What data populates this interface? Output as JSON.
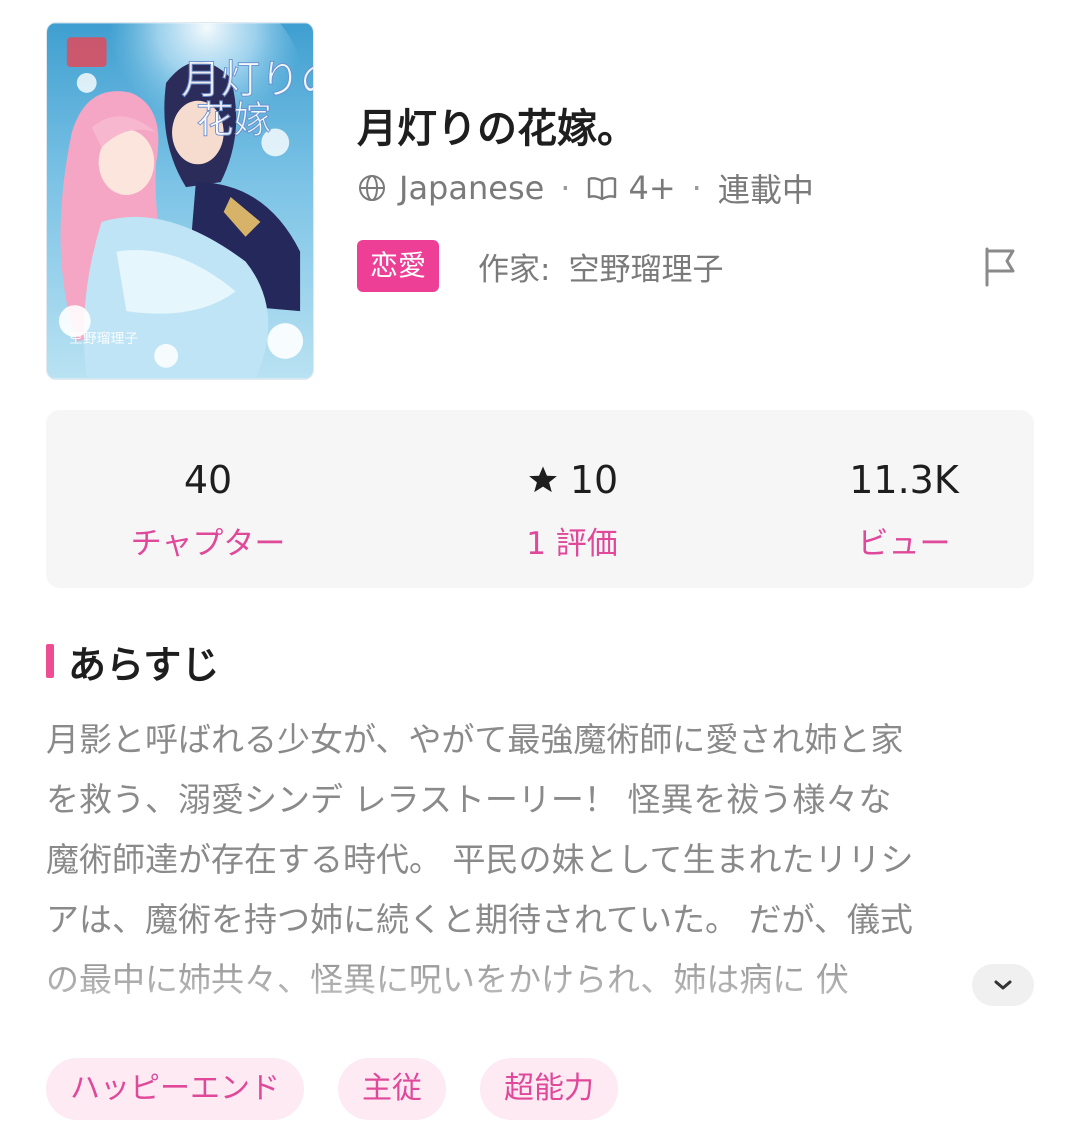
{
  "book": {
    "title": "月灯りの花嫁。",
    "language": "Japanese",
    "age_rating": "4+",
    "status": "連載中",
    "genre": "恋愛",
    "author_label": "作家:",
    "author_name": "空野瑠理子",
    "cover_icon": "manga-cover-illustration"
  },
  "stats": {
    "chapters": {
      "value": "40",
      "label": "チャプター"
    },
    "rating": {
      "value": "10",
      "label": "1 評価",
      "icon": "star-icon"
    },
    "views": {
      "value": "11.3K",
      "label": "ビュー"
    }
  },
  "synopsis": {
    "heading": "あらすじ",
    "lines": [
      "月影と呼ばれる少女が、やがて最強魔術師に愛され姉と家",
      "を救う、溺愛シンデ レラストーリー！ 怪異を祓う様々な",
      "魔術師達が存在する時代。 平民の妹として生まれたリリシ",
      "アは、魔術を持つ姉に続くと期待されていた。 だが、儀式",
      "の最中に姉共々、怪異に呪いをかけられ、姉は病に 伏"
    ],
    "expand_icon": "chevron-down-icon"
  },
  "tags": [
    "ハッピーエンド",
    "主従",
    "超能力"
  ],
  "colors": {
    "accent": "#ee3f96",
    "accent_text": "#e0489a",
    "tag_bg": "#fdeaf3",
    "stats_bg": "#f6f6f7"
  }
}
